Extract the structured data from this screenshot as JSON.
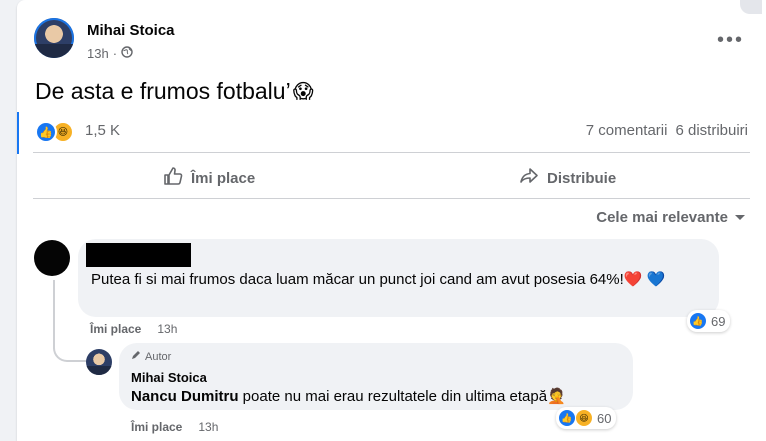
{
  "post": {
    "author": "Mihai Stoica",
    "time": "13h",
    "privacy_icon": "globe-icon",
    "more_label": "•••",
    "text": "De asta e frumos fotbalu’",
    "text_emoji": "😱",
    "reactions": {
      "icons": [
        "like-icon",
        "haha-icon"
      ],
      "count": "1,5 K"
    },
    "comments_count": "7 comentarii",
    "shares_count": "6 distribuiri"
  },
  "actions": {
    "like_label": "Îmi place",
    "share_label": "Distribuie"
  },
  "sort": {
    "label": "Cele mai relevante"
  },
  "comments": [
    {
      "author_redacted": true,
      "text": "Putea fi si mai frumos daca luam măcar un punct joi cand am avut posesia 64%!",
      "emojis": "❤️ 💙",
      "like_label": "Îmi place",
      "time": "13h",
      "reaction_count": "69"
    },
    {
      "badge": "Autor",
      "author": "Mihai Stoica",
      "mention": "Nancu Dumitru",
      "text": " poate nu mai erau rezultatele din ultima etapă",
      "emoji": "🤦",
      "like_label": "Îmi place",
      "time": "13h",
      "reaction_count": "60"
    }
  ],
  "colors": {
    "accent": "#1877f2",
    "text_secondary": "#65676b",
    "bubble": "#f0f2f5"
  }
}
